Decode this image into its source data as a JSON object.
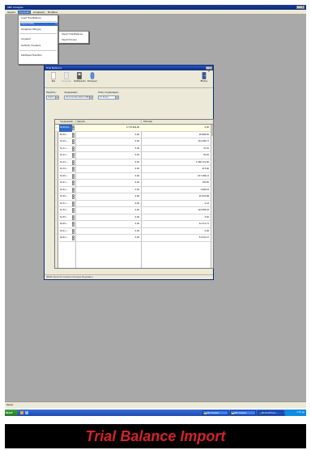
{
  "app": {
    "title": "ABC Analysis",
    "window_controls": "_ ▢ X"
  },
  "menu": {
    "items": [
      "Αρχείο",
      "Λογισμός",
      "Αναφορές",
      "Βοήθεια"
    ],
    "active_index": 1
  },
  "menu_dropdown": {
    "items": [
      "Insert Trial Balance",
      "Import Data",
      "Ανομαλίες Ελεγχος",
      "Λογισμός",
      "Ανάλυση Λογισμού",
      "Κλείδωμα Περιόδου"
    ],
    "highlighted_index": 1,
    "submenu_arrow": "▸"
  },
  "submenu": {
    "items": [
      "Import Trial Balance",
      "Import Drivers"
    ]
  },
  "tb_window": {
    "title": "Trial Balance",
    "window_controls": "_ ▢ X",
    "toolbar": {
      "new_label": "Νέο",
      "delete_label": "Διαγραφή",
      "save_label": "Αποθήκευση",
      "import_label": "Εισαγωγή",
      "exit_label": "Εξοδος"
    },
    "filters": {
      "period_label": "Περίοδος :",
      "period_value": "2009/1",
      "account_label": "Λογαριασμός :",
      "account_value": "00.00.00 BALANCE SHEET",
      "type_label": "Τύπος Λογαριασμού :",
      "type_value": "01 Έσοδα"
    },
    "grid": {
      "columns": [
        "Λογαριασμός",
        "Χρέωση",
        "Πίστωση"
      ],
      "row_indicator": "▸",
      "rows": [
        {
          "code": "00.00.00-...",
          "debit": "5.776.926,66",
          "credit": "0,00"
        },
        {
          "code": "60.00-...",
          "debit": "0,00",
          "credit": "26.968,65"
        },
        {
          "code": "61.10-...",
          "debit": "0,00",
          "credit": "161.446,77"
        },
        {
          "code": "61.11-...",
          "debit": "0,00",
          "credit": "47.61"
        },
        {
          "code": "61.12-...",
          "debit": "0,00",
          "credit": "94,26"
        },
        {
          "code": "61.13-...",
          "debit": "0,00",
          "credit": "1.066.772,90"
        },
        {
          "code": "61.14-...",
          "debit": "0,00",
          "credit": "213,60"
        },
        {
          "code": "61.20-...",
          "debit": "0,00",
          "credit": "617.186,12"
        },
        {
          "code": "61.21-...",
          "debit": "0,00",
          "credit": "765,85"
        },
        {
          "code": "61.22-...",
          "debit": "0,00",
          "credit": "1.928,63"
        },
        {
          "code": "61.30-...",
          "debit": "0,00",
          "credit": "20.470,86"
        },
        {
          "code": "61.31-...",
          "debit": "0,00",
          "credit": "2,43"
        },
        {
          "code": "61.34-...",
          "debit": "0,00",
          "credit": "124.558,42"
        },
        {
          "code": "61.35-...",
          "debit": "0,00",
          "credit": "5,50"
        },
        {
          "code": "64.05-...",
          "debit": "0,00",
          "credit": "42.712,71"
        },
        {
          "code": "64.41-...",
          "debit": "0,00",
          "credit": "0,00"
        },
        {
          "code": "64.42-...",
          "debit": "0,00",
          "credit": "51.541,47"
        }
      ]
    },
    "status_text": "[MAST] Οριστικά Ανάλυση Λογισμού (Εγγραφές)"
  },
  "app_status": "Ready",
  "taskbar": {
    "start_label": "Start",
    "tasks": [
      {
        "label": "ABC Analysis",
        "active": false
      },
      {
        "label": "ABC Analysis",
        "active": false
      },
      {
        "label": "Microsoft Excel ...",
        "active": true
      }
    ],
    "clock": "2:55 μμ"
  },
  "caption": "Trial Balance Import",
  "colors": {
    "caption_text": "#d2232a",
    "selection": "#316ac5",
    "workspace": "#a9a9a9"
  }
}
